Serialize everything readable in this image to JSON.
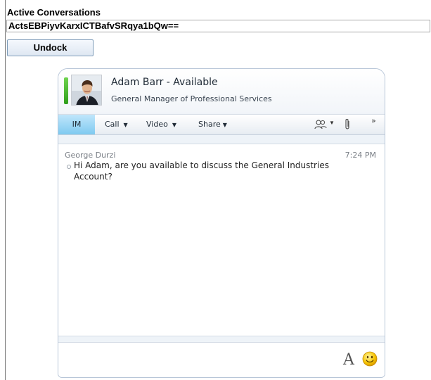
{
  "header": {
    "title": "Active Conversations",
    "conversation_id": "ActsEBPiyvKarxICTBafvSRqya1bQw==",
    "undock_label": "Undock"
  },
  "contact": {
    "name": "Adam Barr - Available",
    "title": "General Manager of Professional Services",
    "presence_color": "#3cb02a"
  },
  "toolbar": {
    "tabs": [
      {
        "label": "IM"
      },
      {
        "label": "Call"
      },
      {
        "label": "Video"
      },
      {
        "label": "Share"
      }
    ],
    "icons": [
      "people-icon",
      "paperclip-icon",
      "more-icon"
    ],
    "more_glyph": "»"
  },
  "conversation": {
    "sender": "George Durzi",
    "time": "7:24 PM",
    "message": "Hi Adam, are you available to discuss the General Industries Account?"
  },
  "compose": {
    "icons": [
      "font-icon",
      "emoticon-icon"
    ],
    "font_glyph": "A"
  }
}
